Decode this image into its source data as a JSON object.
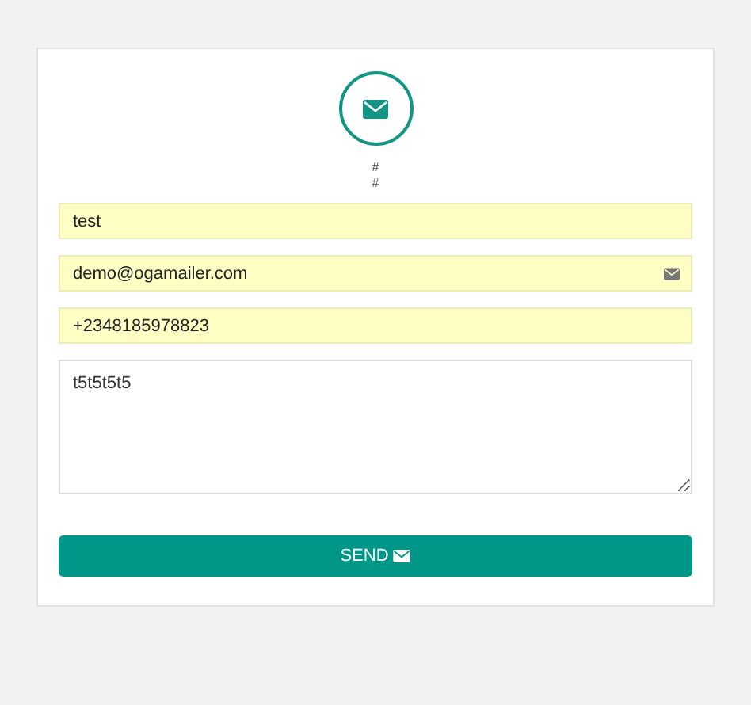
{
  "header": {
    "lines": [
      "#",
      "#"
    ]
  },
  "fields": [
    {
      "kind": "input",
      "value": "test",
      "icon": false
    },
    {
      "kind": "input",
      "value": "demo@ogamailer.com",
      "icon": true
    },
    {
      "kind": "input",
      "value": "+2348185978823",
      "icon": false
    },
    {
      "kind": "textarea",
      "value": "t5t5t5t5"
    }
  ],
  "button": {
    "label": "SEND"
  }
}
